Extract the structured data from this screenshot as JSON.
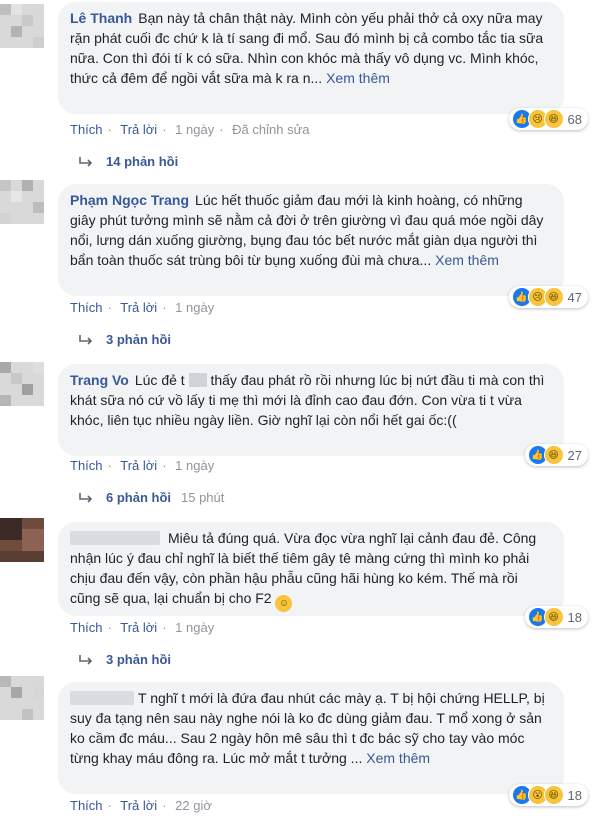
{
  "comments": [
    {
      "author": "Lê Thanh",
      "text": "Bạn này tả chân thật này. Mình còn yếu phải thở cả oxy nữa may rặn phát cuối đc chứ k là tí sang đi mổ. Sau đó mình bị cả combo tắc tia sữa nữa. Con thì đói tí k có sữa. Nhìn con khóc mà thấy vô dụng vc. Mình khóc, thức cả đêm để ngồi vắt sữa mà k ra n...",
      "more": "Xem thêm",
      "reaction_count": "68",
      "like": "Thích",
      "reply": "Trả lời",
      "time": "1 ngày",
      "edited": "Đã chỉnh sửa",
      "replies_label": "14 phản hồi"
    },
    {
      "author": "Phạm Ngọc Trang",
      "text": "Lúc hết thuốc giảm đau mới là kinh hoàng, có những giây phút tưởng mình sẽ nằm cả đời ở trên giường vì đau quá móe ngồi dây nổi, lưng dán xuống giường, bụng đau tóc bết nước mắt giàn dụa người thì bẩn toàn thuốc sát trùng bôi từ bụng xuống đùi mà chưa...",
      "more": "Xem thêm",
      "reaction_count": "47",
      "like": "Thích",
      "reply": "Trả lời",
      "time": "1 ngày",
      "replies_label": "3 phản hồi"
    },
    {
      "author": "Trang Vo",
      "text_a": "Lúc đẻ t",
      "text_b": "thấy đau phát rồ rồi nhưng lúc bị nứt đầu ti mà con thì khát sữa nó cứ vồ lấy ti mẹ thì mới là đỉnh cao đau đớn. Con vừa ti t vừa khóc, liên tục nhiều ngày liền. Giờ nghĩ lại còn nổi hết gai ốc:((",
      "reaction_count": "27",
      "like": "Thích",
      "reply": "Trả lời",
      "time": "1 ngày",
      "replies_label": "6 phản hồi",
      "replies_time": "15 phút"
    },
    {
      "text": "Miêu tả đúng quá. Vừa đọc vừa nghĩ lại cảnh đau đẻ. Công nhận lúc ý đau chỉ nghĩ là biết thế tiêm gây tê màng cứng thì mình ko phải chịu đau đến vậy, còn phần hậu phẫu cũng hãi hùng ko kém. Thế mà rồi cũng sẽ qua, lại chuẩn bị cho F2",
      "reaction_count": "18",
      "like": "Thích",
      "reply": "Trả lời",
      "time": "1 ngày",
      "replies_label": "3 phản hồi"
    },
    {
      "text": "T nghĩ t mới là đứa đau nhút các mày ạ. T bị hội chứng HELLP, bị suy đa tạng nên sau này nghe nói là ko đc dùng giảm đau. T mổ xong ở sản ko cầm đc máu... Sau 2 ngày hôn mê sâu thì t đc bác sỹ cho tay vào móc từng khay máu đông ra. Lúc mở mắt t tưởng ...",
      "more": "Xem thêm",
      "reaction_count": "18",
      "like": "Thích",
      "reply": "Trả lời",
      "time": "22 giờ"
    }
  ],
  "icons": {
    "like": "thumbs-up-icon",
    "sad": "sad-face-icon",
    "haha": "laugh-face-icon",
    "wow": "wow-face-icon",
    "reply_arrow": "reply-arrow-icon"
  },
  "colors": {
    "link": "#385898",
    "bubble": "#f2f3f5",
    "meta": "#90949c",
    "like_blue": "#1877f2",
    "emoji_yellow": "#f7c43b"
  }
}
